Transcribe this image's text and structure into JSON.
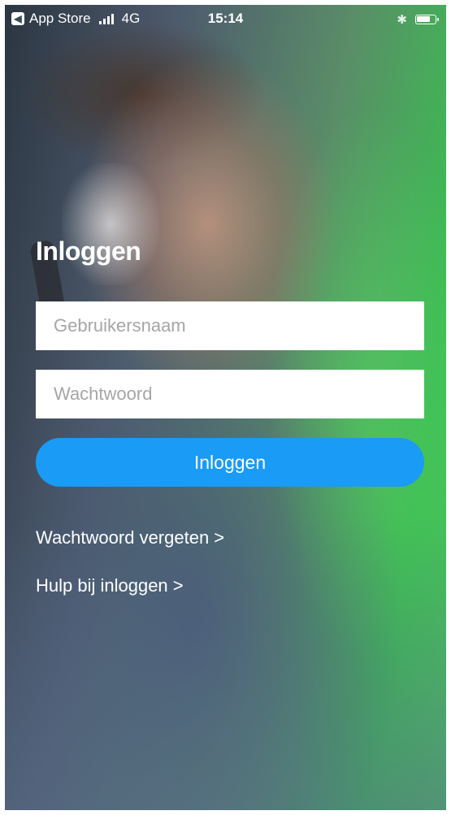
{
  "status_bar": {
    "back_app": "App Store",
    "network": "4G",
    "time": "15:14"
  },
  "login": {
    "title": "Inloggen",
    "username_placeholder": "Gebruikersnaam",
    "password_placeholder": "Wachtwoord",
    "button_label": "Inloggen",
    "forgot_link": "Wachtwoord vergeten >",
    "help_link": "Hulp bij inloggen >"
  },
  "colors": {
    "button": "#1a9bf5",
    "field_background": "#ffffff",
    "placeholder": "#a6a6a6",
    "text": "#ffffff"
  },
  "icons": {
    "back": "back-arrow-icon",
    "signal": "cellular-signal-icon",
    "bluetooth": "bluetooth-icon",
    "battery": "battery-icon"
  }
}
